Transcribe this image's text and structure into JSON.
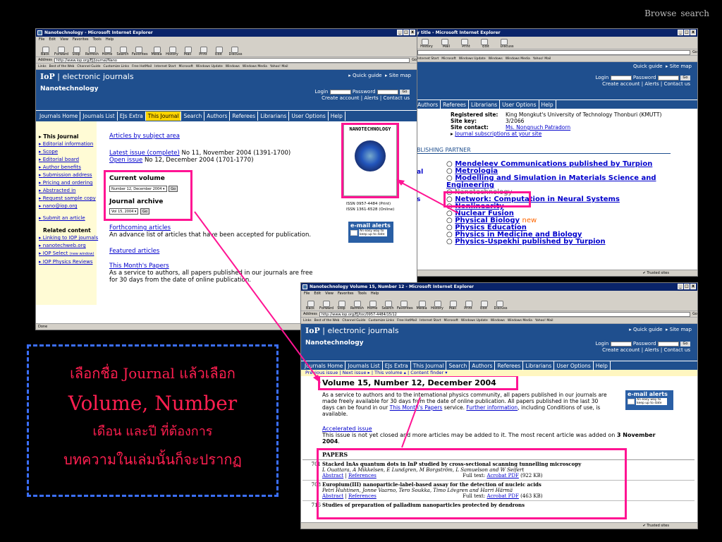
{
  "nav": {
    "browse": "Browse",
    "search": "search"
  },
  "win1": {
    "title": "Nanotechnology - Microsoft Internet Explorer",
    "menu": [
      "File",
      "Edit",
      "View",
      "Favorites",
      "Tools",
      "Help"
    ],
    "toolbar": [
      "Back",
      "Forward",
      "Stop",
      "Refresh",
      "Home",
      "Search",
      "Favorites",
      "Media",
      "History",
      "Mail",
      "Print",
      "Edit",
      "Discuss"
    ],
    "address_label": "Address",
    "address": "http://www.iop.org/EJ/journal/Nano",
    "go": "Go",
    "links_label": "Links",
    "links": [
      "Best of the Web",
      "Channel Guide",
      "Customize Links",
      "Free HotMail",
      "Internet Start",
      "Microsoft",
      "Windows Update",
      "Windows",
      "Windows Media",
      "Yahoo! Mail"
    ],
    "status": "Done"
  },
  "win2": {
    "title": "y title - Microsoft Internet Explorer",
    "toolbar": [
      "History",
      "Mail",
      "Print",
      "Edit",
      "Discuss"
    ],
    "links": [
      "Internet Start",
      "Microsoft",
      "Windows Update",
      "Windows",
      "Windows Media",
      "Yahoo! Mail"
    ],
    "go": "Go",
    "nav": [
      "Authors",
      "Referees",
      "Librarians",
      "User Options",
      "Help"
    ],
    "reg": [
      {
        "label": "Registered site:",
        "value": "King Mongkut's University of Technology Thonburi (KMUTT)"
      },
      {
        "label": "Site key:",
        "value": "3/2066"
      },
      {
        "label": "Site contact:",
        "value": "Ms. Nongnuch Patradorn"
      }
    ],
    "subs": "Journal subscriptions at your site",
    "partner": "BLISHING PARTNER",
    "journals": [
      "Mendeleev Communications published by Turpion",
      "Metrologia",
      "Modelling and Simulation in Materials Science and Engineering",
      "Nanotechnology",
      "Network: Computation in Neural Systems",
      "Nonlinearity",
      "Nuclear Fusion",
      "Physical Biology",
      "Physics Education",
      "Physics in Medicine and Biology",
      "Physics-Uspekhi published by Turpion"
    ],
    "new_badge": "new",
    "frag_al": "al",
    "frag_s": "s",
    "status": "Trusted sites"
  },
  "iop": {
    "logo": "IoP",
    "logo_text": "electronic journals",
    "quick_guide": "Quick guide",
    "site_map": "Site map",
    "journal_name": "Nanotechnology",
    "login": "Login",
    "password": "Password",
    "go": "Go",
    "create_account": "Create account",
    "alerts": "Alerts",
    "contact_us": "Contact us",
    "nav": [
      "Journals Home",
      "Journals List",
      "EJs Extra",
      "This Journal",
      "Search",
      "Authors",
      "Referees",
      "Librarians",
      "User Options",
      "Help"
    ]
  },
  "win1_page": {
    "sidebar_head": "This Journal",
    "sidebar": [
      "Editorial information",
      "Scope",
      "Editorial board",
      "Author benefits",
      "Submission address",
      "Pricing and ordering",
      "Abstracted in",
      "Request sample copy",
      "nano@iop.org"
    ],
    "submit": "Submit an article",
    "related_head": "Related content",
    "related": [
      "Linking to IOP journals",
      "nanotechweb.org",
      "IOP Select",
      "IOP Physics Reviews"
    ],
    "iop_select_note": "(new window)",
    "articles_by_subject": "Articles by subject area",
    "latest_link": "Latest issue (complete)",
    "latest_text": "No 11, November 2004 (1391-1700)",
    "open_link": "Open issue",
    "open_text": "No 12, December 2004 (1701-1770)",
    "current_volume": "Current volume",
    "current_select": "Number 12, December 2004",
    "journal_archive": "Journal archive",
    "archive_select": "Vol 15, 2004",
    "go": "Go",
    "forthcoming": "Forthcoming articles",
    "forthcoming_text": "An advance list of articles that have been accepted for publication.",
    "featured": "Featured articles",
    "months_papers": "This Month's Papers",
    "months_text": "As a service to authors, all papers published in our journals are free for 30 days from the date of online publication.",
    "cover_title": "NANOTECHNOLOGY",
    "issn1": "ISSN 0957-4484 (Print)",
    "issn2": "ISSN 1361-6528 (Online)",
    "email_alerts": "e-mail alerts",
    "email_sub": "An easy way to keep up to date"
  },
  "win3": {
    "title": "Nanotechnology Volume 15, Number 12 - Microsoft Internet Explorer",
    "address": "http://www.iop.org/EJ/toc/0957-4484/15/12",
    "issue_nav": [
      "Previous issue",
      "Next issue",
      "This volume",
      "Content finder"
    ],
    "volume_heading": "Volume 15, Number 12, December 2004",
    "service_text": "As a service to authors and to the international physics community, all papers published in our journals are made freely available for 30 days from the date of online publication. All papers published in the last 30 days can be found in our",
    "service_link": "This Month's Papers",
    "service_tail": "service.",
    "further": "Further information",
    "further_tail": ", including Conditions of use, is available.",
    "accelerated": "Accelerated issue",
    "accelerated_text": "This issue is not yet closed and more articles may be added to it. The most recent article was added on",
    "accelerated_date": "3 November 2004",
    "papers_head": "PAPERS",
    "email_alerts": "e-mail alerts",
    "email_sub": "An easy way to keep up to date",
    "papers": [
      {
        "page": "701",
        "title": "Stacked InAs quantum dots in InP studied by cross-sectional scanning tunnelling microscopy",
        "authors": "L Ouattara, A Mikkelsen, E Lundgren, M Borgström, L Samuelson and W Seifert",
        "abstract": "Abstract",
        "refs": "References",
        "fulltext": "Full text:",
        "pdf": "Acrobat PDF",
        "size": "(922 KB)"
      },
      {
        "page": "708",
        "title": "Europium(III) nanoparticle-label-based assay for the detection of nucleic acids",
        "authors": "Petri Huhtinen, Jonne Vaarno, Tero Soukka, Timo Lövgren and Harri Härmä",
        "abstract": "Abstract",
        "refs": "References",
        "fulltext": "Full text:",
        "pdf": "Acrobat PDF",
        "size": "(463 KB)"
      },
      {
        "page": "716",
        "title": "Studies of preparation of palladium nanoparticles protected by dendrons"
      }
    ],
    "status": "Trusted sites"
  },
  "note": {
    "line1": "เลือกชื่อ Journal แล้วเลือก",
    "line2": "Volume, Number",
    "line3": "เดือน และปี ที่ต้องการ",
    "line4": "บทความในเล่มนั้นก็จะปรากฏ"
  },
  "colors": {
    "accent": "#ff1493",
    "iop_blue": "#1f4f8e",
    "highlight": "#ffd400",
    "note_text": "#ff1f50",
    "note_border": "#3b6fff"
  }
}
